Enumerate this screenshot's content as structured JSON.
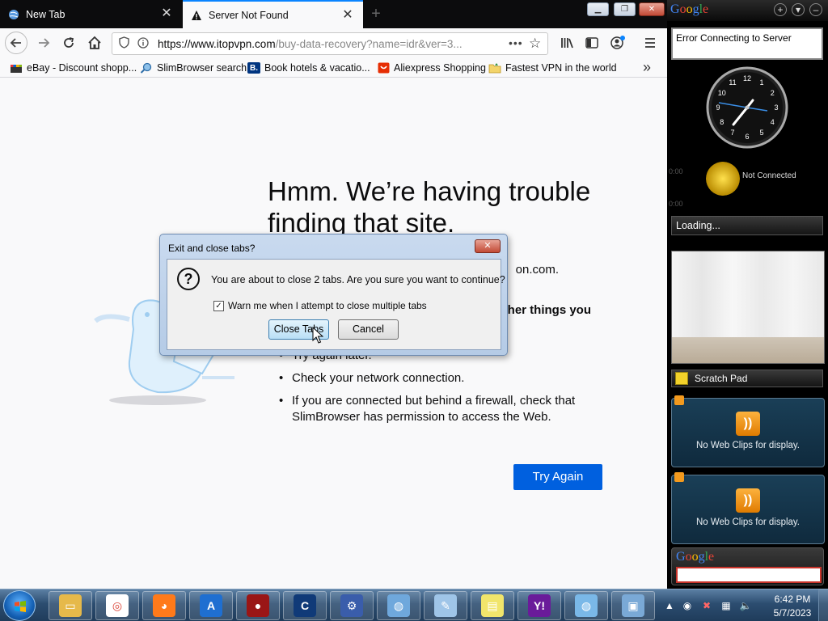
{
  "browser": {
    "tabs": [
      {
        "label": "New Tab",
        "active": false,
        "icon": "globe-icon"
      },
      {
        "label": "Server Not Found",
        "active": true,
        "icon": "warning-icon"
      }
    ],
    "url_host": "https://www.itopvpn.com",
    "url_path": "/buy-data-recovery?name=idr&ver=3...",
    "bookmarks": [
      {
        "label": "eBay - Discount shopp...",
        "icon": "ebay-icon"
      },
      {
        "label": "SlimBrowser search",
        "icon": "search-icon"
      },
      {
        "label": "Book hotels & vacatio...",
        "icon": "booking-icon",
        "glyph": "B."
      },
      {
        "label": "Aliexpress Shopping",
        "icon": "aliexpress-icon"
      },
      {
        "label": "Fastest VPN in the world",
        "icon": "vpn-folder-icon"
      }
    ]
  },
  "error_page": {
    "title": "Hmm. We’re having trouble finding that site.",
    "domain_fragment": "on.com.",
    "subtitle_fragment": "her things you",
    "bullets": [
      "Try again later.",
      "Check your network connection.",
      "If you are connected but behind a firewall, check that SlimBrowser has permission to access the Web."
    ],
    "try_again_label": "Try Again"
  },
  "dialog": {
    "title": "Exit and close tabs?",
    "message": "You are about to close 2 tabs. Are you sure you want to continue?",
    "checkbox_label": "Warn me when I attempt to close multiple tabs",
    "checkbox_checked": true,
    "primary_label": "Close Tabs",
    "cancel_label": "Cancel"
  },
  "sidebar": {
    "logo": "Google",
    "news_text": "Error Connecting to Server",
    "clock": {
      "numbers": [
        "12",
        "1",
        "2",
        "3",
        "4",
        "5",
        "6",
        "7",
        "8",
        "9",
        "10",
        "11"
      ]
    },
    "weather_status": "Not Connected",
    "faint_labels": [
      "0:00",
      "0:00"
    ],
    "loading_text": "Loading...",
    "scratch_label": "Scratch Pad",
    "web_clips_text": "No Web Clips for display.",
    "search_logo": "Google"
  },
  "taskbar": {
    "items": [
      {
        "name": "explorer",
        "icon": "folder-icon",
        "color": "#e6b94a"
      },
      {
        "name": "chrome",
        "icon": "chrome-icon",
        "color": "#ffffff"
      },
      {
        "name": "firefox",
        "icon": "firefox-icon",
        "color": "#ff7a1a"
      },
      {
        "name": "app-a",
        "icon": "a-app-icon",
        "color": "#1f6fd1"
      },
      {
        "name": "app-red",
        "icon": "red-sphere-icon",
        "color": "#9a1616"
      },
      {
        "name": "ccleaner",
        "icon": "ccleaner-icon",
        "color": "#103a78"
      },
      {
        "name": "settings-app",
        "icon": "settings-app-icon",
        "color": "#3a5dab"
      },
      {
        "name": "globe-app",
        "icon": "globe-app-icon",
        "color": "#6fa8dc"
      },
      {
        "name": "notepad",
        "icon": "notepad-icon",
        "color": "#9fc5e8"
      },
      {
        "name": "notes",
        "icon": "sticky-notes-icon",
        "color": "#f1e56b"
      },
      {
        "name": "yahoo",
        "icon": "yahoo-messenger-icon",
        "color": "#6a1b9a"
      },
      {
        "name": "slimbrowser",
        "icon": "slimbrowser-icon",
        "color": "#7ab8e8"
      },
      {
        "name": "screenshot",
        "icon": "screenshot-icon",
        "color": "#7aa9d6"
      }
    ],
    "time": "6:42 PM",
    "date": "5/7/2023"
  }
}
